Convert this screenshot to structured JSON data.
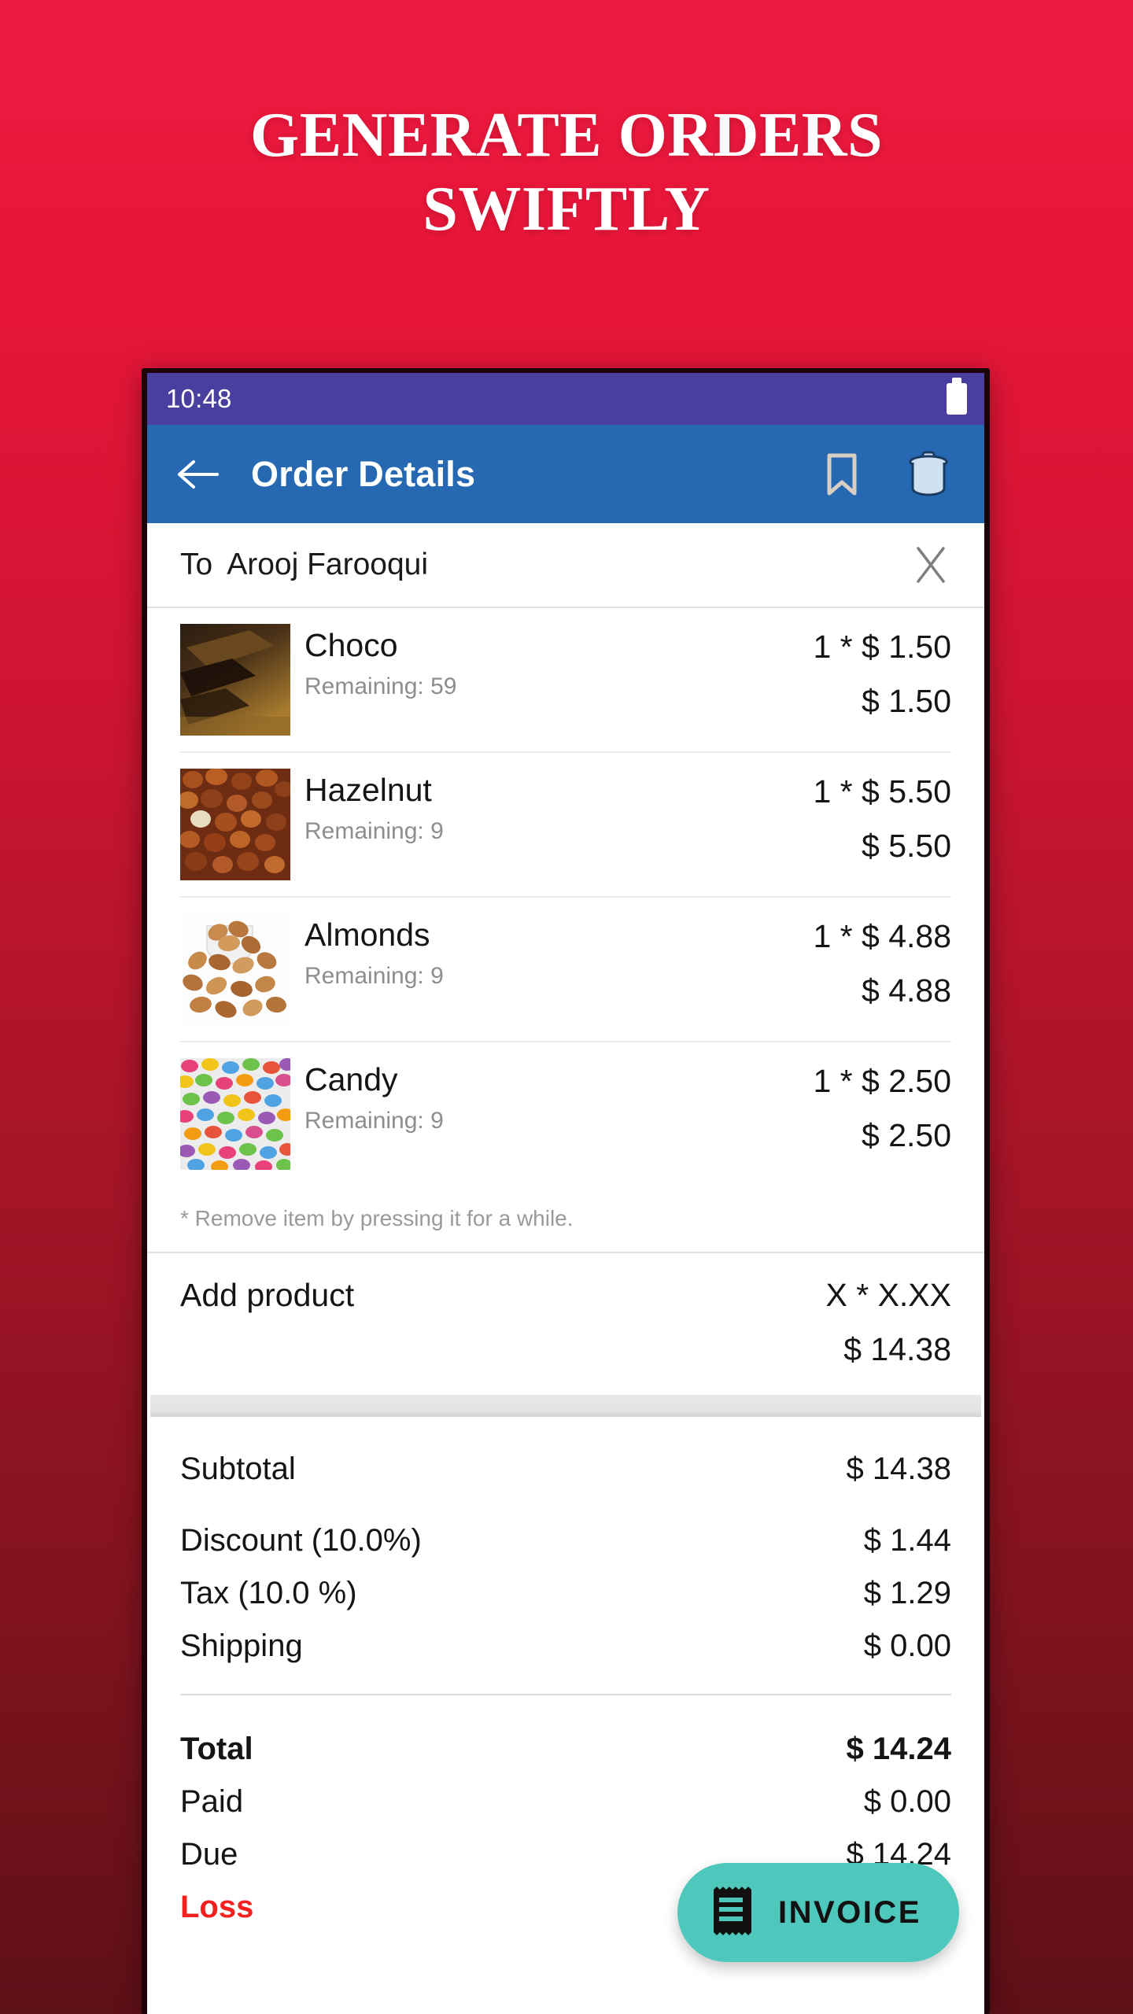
{
  "promo": {
    "headline_line1": "GENERATE ORDERS",
    "headline_line2": "SWIFTLY",
    "background_top_color": "#ee1b41",
    "background_bottom_color": "#5e1017"
  },
  "statusbar": {
    "time": "10:48",
    "battery_icon": "battery-full-icon",
    "background_color": "#4a3f9e"
  },
  "appbar": {
    "back_icon": "arrow-left-icon",
    "title": "Order Details",
    "bookmark_icon": "bookmark-icon",
    "delete_icon": "trash-icon",
    "background_color": "#2668b1"
  },
  "recipient": {
    "label": "To",
    "name": "Arooj Farooqui",
    "clear_icon": "close-x-icon"
  },
  "items": [
    {
      "name": "Choco",
      "remaining": "Remaining: 59",
      "qty_price": "1 * $ 1.50",
      "line_total": "$ 1.50",
      "thumb": "chocolate-bar-photo"
    },
    {
      "name": "Hazelnut",
      "remaining": "Remaining: 9",
      "qty_price": "1 * $ 5.50",
      "line_total": "$ 5.50",
      "thumb": "hazelnuts-photo"
    },
    {
      "name": "Almonds",
      "remaining": "Remaining: 9",
      "qty_price": "1 * $ 4.88",
      "line_total": "$ 4.88",
      "thumb": "almonds-photo"
    },
    {
      "name": "Candy",
      "remaining": "Remaining: 9",
      "qty_price": "1 * $ 2.50",
      "line_total": "$ 2.50",
      "thumb": "candy-photo"
    }
  ],
  "remove_hint": "* Remove item by pressing it for a while.",
  "add_product": {
    "label": "Add product",
    "qty_price": "X * X.XX",
    "line_total": "$ 14.38"
  },
  "summary": {
    "subtotal_label": "Subtotal",
    "subtotal_value": "$ 14.38",
    "discount_label": "Discount (10.0%)",
    "discount_value": "$ 1.44",
    "tax_label": "Tax (10.0 %)",
    "tax_value": "$ 1.29",
    "shipping_label": "Shipping",
    "shipping_value": "$ 0.00",
    "total_label": "Total",
    "total_value": "$ 14.24",
    "paid_label": "Paid",
    "paid_value": "$ 0.00",
    "due_label": "Due",
    "due_value": "$ 14.24",
    "loss_label": "Loss",
    "loss_color": "#f32020"
  },
  "fab": {
    "label": "INVOICE",
    "icon": "receipt-icon",
    "color": "#4ec8bc"
  }
}
